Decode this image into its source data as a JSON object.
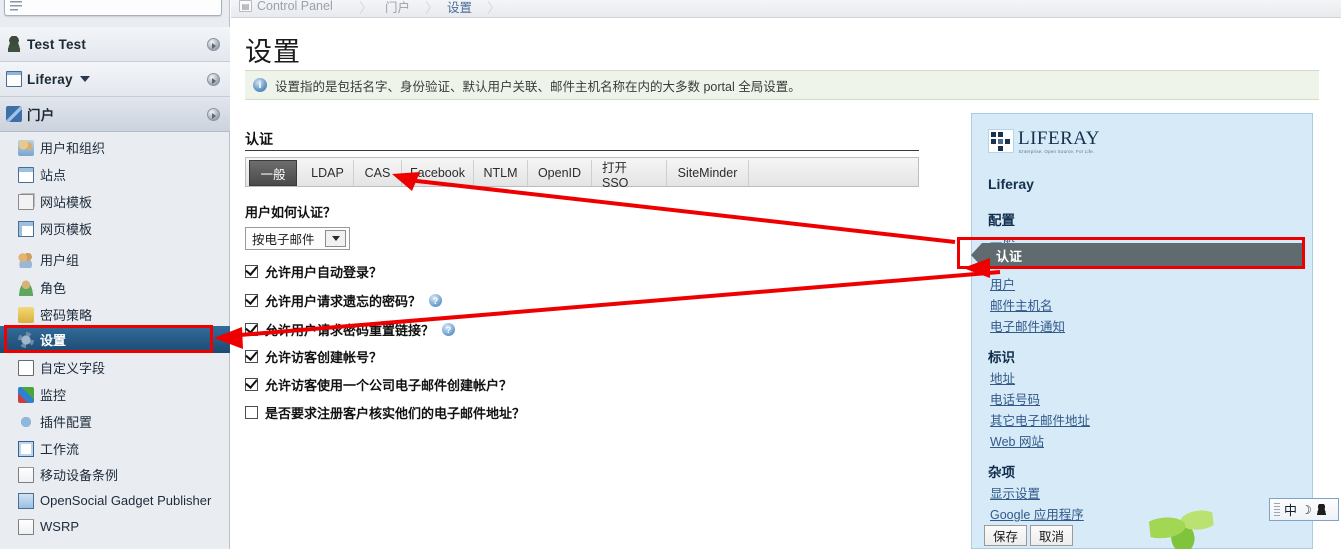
{
  "search": {
    "placeholder": ""
  },
  "sidebar": {
    "headers": [
      {
        "label": "Test Test",
        "icon": "person-icon",
        "caret": false
      },
      {
        "label": "Liferay",
        "icon": "window-icon",
        "caret": true
      },
      {
        "label": "门户",
        "icon": "portal-icon",
        "caret": false
      }
    ],
    "items": [
      {
        "label": "用户和组织",
        "icon": "users-icon"
      },
      {
        "label": "站点",
        "icon": "site-icon"
      },
      {
        "label": "网站模板",
        "icon": "site-template-icon"
      },
      {
        "label": "网页模板",
        "icon": "page-template-icon"
      },
      {
        "label": "用户组",
        "icon": "user-group-icon"
      },
      {
        "label": "角色",
        "icon": "role-icon"
      },
      {
        "label": "密码策略",
        "icon": "password-icon"
      },
      {
        "label": "设置",
        "icon": "gear-icon",
        "selected": true
      },
      {
        "label": "自定义字段",
        "icon": "custom-field-icon"
      },
      {
        "label": "监控",
        "icon": "monitor-icon"
      },
      {
        "label": "插件配置",
        "icon": "plugin-icon"
      },
      {
        "label": "工作流",
        "icon": "workflow-icon"
      },
      {
        "label": "移动设备条例",
        "icon": "folder-icon"
      },
      {
        "label": "OpenSocial Gadget Publisher",
        "icon": "gadget-icon"
      },
      {
        "label": "WSRP",
        "icon": "folder-icon"
      }
    ]
  },
  "breadcrumb": {
    "items": [
      {
        "label": "Control Panel",
        "icon": "control-panel-icon",
        "active": false
      },
      {
        "label": "门户",
        "active": false
      },
      {
        "label": "设置",
        "active": true
      }
    ],
    "separator": "〉"
  },
  "page": {
    "title": "设置",
    "info_icon": "info-icon",
    "info_text": "设置指的是包括名字、身份验证、默认用户关联、邮件主机名称在内的大多数 portal 全局设置。"
  },
  "section": {
    "title": "认证",
    "tabs": [
      {
        "label": "一般",
        "selected": true
      },
      {
        "label": "LDAP",
        "selected": false
      },
      {
        "label": "CAS",
        "selected": false
      },
      {
        "label": "Facebook",
        "selected": false
      },
      {
        "label": "NTLM",
        "selected": false
      },
      {
        "label": "OpenID",
        "selected": false
      },
      {
        "label": "打开 SSO",
        "selected": false
      },
      {
        "label": "SiteMinder",
        "selected": false
      }
    ]
  },
  "form": {
    "auth_question": "用户如何认证？",
    "auth_select_value": "按电子邮件",
    "checkboxes": [
      {
        "label": "允许用户自动登录？",
        "checked": true,
        "help": false
      },
      {
        "label": "允许用户请求遗忘的密码？",
        "checked": true,
        "help": true
      },
      {
        "label": "允许用户请求密码重置链接？",
        "checked": true,
        "help": true
      },
      {
        "label": "允许访客创建帐号？",
        "checked": true,
        "help": false
      },
      {
        "label": "允许访客使用一个公司电子邮件创建帐户？",
        "checked": true,
        "help": false
      },
      {
        "label": "是否要求注册客户核实他们的电子邮件地址？",
        "checked": false,
        "help": false
      }
    ],
    "help_glyph": "?"
  },
  "right_panel": {
    "logo_word": "LIFERAY",
    "logo_tagline": "Enterprise. Open Source. For Life.",
    "company": "Liferay",
    "groups": [
      {
        "heading": "配置",
        "links": [
          "一般",
          "认证",
          "用户",
          "邮件主机名",
          "电子邮件通知"
        ],
        "highlighted": "认证"
      },
      {
        "heading": "标识",
        "links": [
          "地址",
          "电话号码",
          "其它电子邮件地址",
          "Web 网站"
        ]
      },
      {
        "heading": "杂项",
        "links": [
          "显示设置",
          "Google 应用程序"
        ]
      }
    ],
    "save_label": "保存",
    "cancel_label": "取消"
  },
  "ime": {
    "mode": "中",
    "moon_glyph": "☽",
    "user_icon": "user-icon"
  },
  "annotation": {
    "color": "#ee0000"
  }
}
